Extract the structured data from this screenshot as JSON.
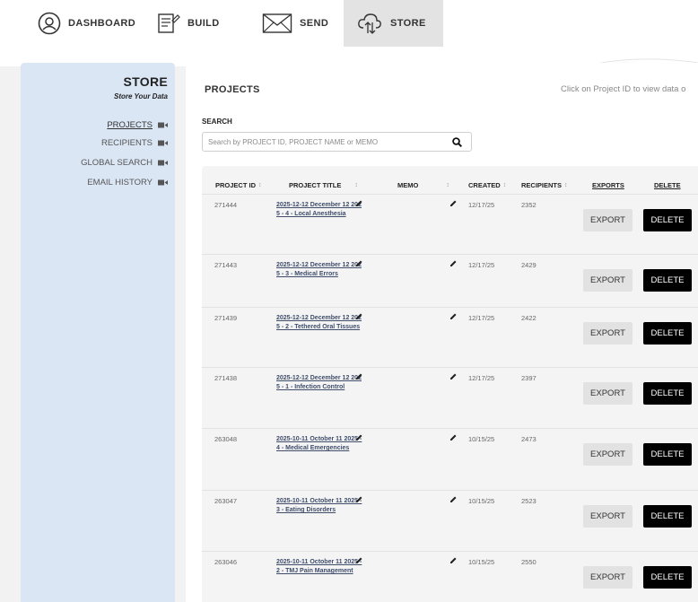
{
  "nav": {
    "dashboard": "DASHBOARD",
    "build": "BUILD",
    "send": "SEND",
    "store": "STORE"
  },
  "sidebar": {
    "title": "STORE",
    "subtitle": "Store Your Data",
    "items": [
      {
        "label": "PROJECTS"
      },
      {
        "label": "RECIPIENTS"
      },
      {
        "label": "GLOBAL SEARCH"
      },
      {
        "label": "EMAIL HISTORY"
      }
    ]
  },
  "main": {
    "title": "PROJECTS",
    "hint": "Click on Project ID to view data o",
    "search_label": "SEARCH",
    "search_placeholder": "Search by PROJECT ID, PROJECT NAME or MEMO"
  },
  "table": {
    "headers": {
      "project_id": "PROJECT ID",
      "project_title": "PROJECT TITLE",
      "memo": "MEMO",
      "created": "CREATED",
      "recipients": "RECIPIENTS",
      "exports": "EXPORTS",
      "delete": "DELETE",
      "sort_glyph": "↕"
    },
    "export_label": "EXPORT",
    "delete_label": "DELETE",
    "rows": [
      {
        "id": "271444",
        "title": "2025-12-12 December 12 2025 - 4 - Local Anesthesia",
        "created": "12/17/25",
        "recipients": "2352"
      },
      {
        "id": "271443",
        "title": "2025-12-12 December 12 2025 - 3 - Medical Errors",
        "created": "12/17/25",
        "recipients": "2429"
      },
      {
        "id": "271439",
        "title": "2025-12-12 December 12 2025 - 2 - Tethered Oral Tissues",
        "created": "12/17/25",
        "recipients": "2422"
      },
      {
        "id": "271438",
        "title": "2025-12-12 December 12 2025 - 1 - Infection Control",
        "created": "12/17/25",
        "recipients": "2397"
      },
      {
        "id": "263048",
        "title": "2025-10-11 October 11 2025 - 4 - Medical Emergencies",
        "created": "10/15/25",
        "recipients": "2473"
      },
      {
        "id": "263047",
        "title": "2025-10-11 October 11 2025 - 3 - Eating Disorders",
        "created": "10/15/25",
        "recipients": "2523"
      },
      {
        "id": "263046",
        "title": "2025-10-11 October 11 2025 - 2 - TMJ Pain Management",
        "created": "10/15/25",
        "recipients": "2550"
      }
    ]
  },
  "colors": {
    "sidebar_bg": "#dbe6f5",
    "link": "#3f4d6b",
    "delete_bg": "#000000",
    "export_bg": "#e2e2e2"
  }
}
